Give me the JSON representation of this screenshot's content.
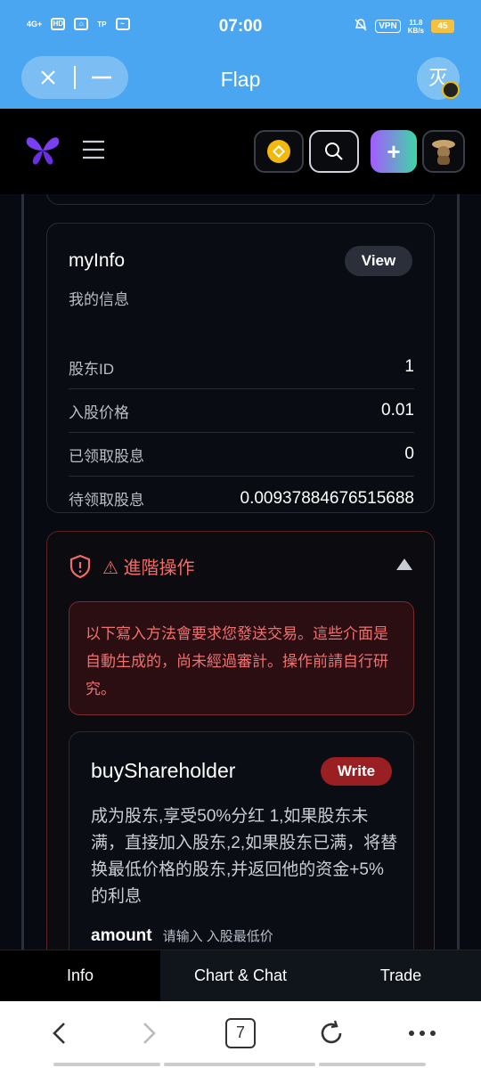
{
  "status_bar": {
    "network": "4G+",
    "hd": "HD",
    "time": "07:00",
    "vpn": "VPN",
    "speed_value": "11.8",
    "speed_unit": "KB/s",
    "battery": "45"
  },
  "browser": {
    "title": "Flap",
    "avatar_char": "灭",
    "tab_count": "7"
  },
  "myinfo": {
    "title": "myInfo",
    "view_label": "View",
    "subtitle": "我的信息",
    "rows": [
      {
        "label": "股东ID",
        "value": "1"
      },
      {
        "label": "入股价格",
        "value": "0.01"
      },
      {
        "label": "已领取股息",
        "value": "0"
      },
      {
        "label": "待领取股息",
        "value": "0.00937884676515688"
      }
    ]
  },
  "advanced": {
    "title": "⚠ 進階操作",
    "warning": "以下寫入方法會要求您發送交易。這些介面是自動生成的，尚未經過審計。操作前請自行研究。",
    "function": {
      "name": "buyShareholder",
      "write_label": "Write",
      "description": "成为股东,享受50%分红 1,如果股东未满，直接加入股东,2,如果股东已满，将替换最低价格的股东,并返回他的资金+5%的利息",
      "param_name": "amount",
      "param_hint": "请输入 入股最低价"
    }
  },
  "tabs": [
    {
      "label": "Info",
      "active": true
    },
    {
      "label": "Chart & Chat",
      "active": false
    },
    {
      "label": "Trade",
      "active": false
    }
  ],
  "colors": {
    "accent_purple": "#7b3ff2",
    "danger": "#f26b68",
    "browser_blue": "#4aa6f0"
  }
}
